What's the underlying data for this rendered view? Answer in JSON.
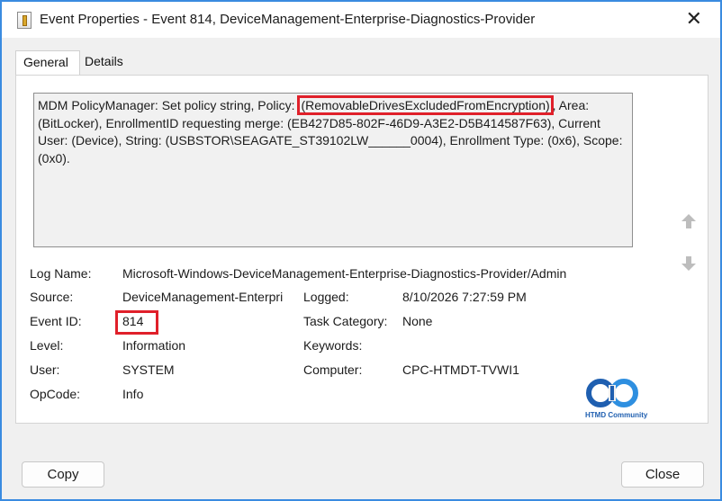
{
  "window": {
    "title": "Event Properties - Event 814, DeviceManagement-Enterprise-Diagnostics-Provider",
    "close_glyph": "✕"
  },
  "tabs": [
    {
      "label": "General",
      "active": true
    },
    {
      "label": "Details",
      "active": false
    }
  ],
  "description": {
    "prefix": "MDM PolicyManager: Set policy string, Policy: ",
    "highlighted": "(RemovableDrivesExcludedFromEncryption)",
    "suffix": ", Area: (BitLocker), EnrollmentID requesting merge: (EB427D85-802F-46D9-A3E2-D5B414587F63), Current User: (Device), String: (USBSTOR\\SEAGATE_ST39102LW______0004), Enrollment Type: (0x6), Scope: (0x0)."
  },
  "fields": {
    "log_name_label": "Log Name:",
    "log_name_value": "Microsoft-Windows-DeviceManagement-Enterprise-Diagnostics-Provider/Admin",
    "source_label": "Source:",
    "source_value": "DeviceManagement-Enterpri",
    "logged_label": "Logged:",
    "logged_value": "8/10/2026 7:27:59 PM",
    "event_id_label": "Event ID:",
    "event_id_value": "814",
    "task_category_label": "Task Category:",
    "task_category_value": "None",
    "level_label": "Level:",
    "level_value": "Information",
    "keywords_label": "Keywords:",
    "keywords_value": "",
    "user_label": "User:",
    "user_value": "SYSTEM",
    "computer_label": "Computer:",
    "computer_value": "CPC-HTMDT-TVWI1",
    "opcode_label": "OpCode:",
    "opcode_value": "Info"
  },
  "logo": {
    "text": "HTMD Community"
  },
  "buttons": {
    "copy": "Copy",
    "close": "Close"
  },
  "icons": {
    "up": "arrow-up-icon",
    "down": "arrow-down-icon"
  },
  "colors": {
    "highlight": "#e0202a",
    "accent": "#3a8be0"
  }
}
